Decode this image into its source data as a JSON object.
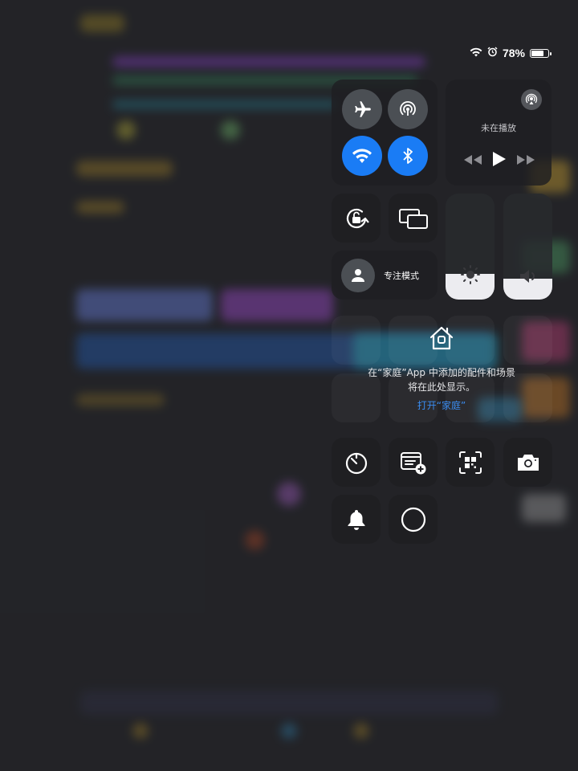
{
  "status": {
    "battery_text": "78%",
    "battery_level": 0.78
  },
  "now_playing": {
    "title": "未在播放"
  },
  "focus": {
    "label": "专注模式"
  },
  "sliders": {
    "brightness_level": 0.24,
    "volume_level": 0.2
  },
  "home": {
    "line1": "在“家庭”App 中添加的配件和场景",
    "line2": "将在此处显示。",
    "link": "打开“家庭”"
  },
  "colors": {
    "accent": "#1a7cf5",
    "link": "#3a8cf0"
  }
}
